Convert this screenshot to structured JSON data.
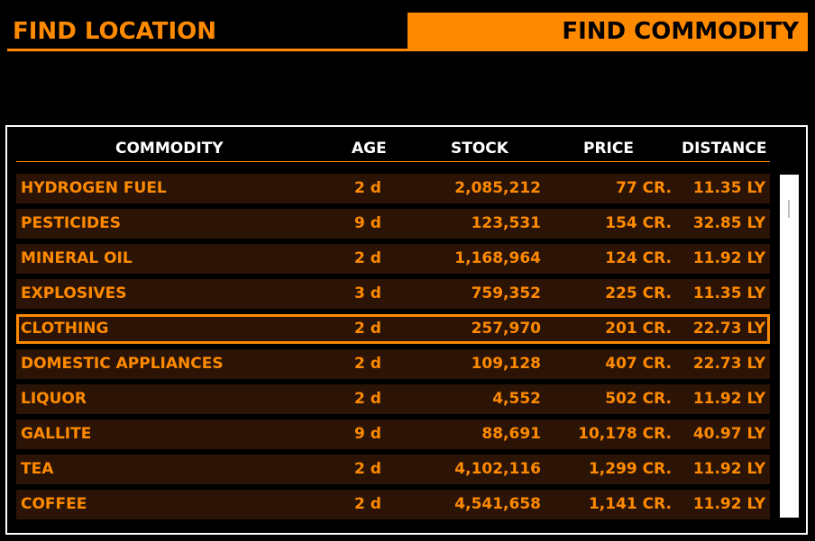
{
  "tabs": {
    "find_location": "FIND LOCATION",
    "find_commodity": "FIND COMMODITY",
    "active": "find_commodity"
  },
  "table": {
    "headers": {
      "commodity": "COMMODITY",
      "age": "AGE",
      "stock": "STOCK",
      "price": "PRICE",
      "distance": "DISTANCE"
    },
    "rows": [
      {
        "commodity": "HYDROGEN FUEL",
        "age": "2 d",
        "stock": "2,085,212",
        "price": "77 CR.",
        "distance": "11.35 LY"
      },
      {
        "commodity": "PESTICIDES",
        "age": "9 d",
        "stock": "123,531",
        "price": "154 CR.",
        "distance": "32.85 LY"
      },
      {
        "commodity": "MINERAL OIL",
        "age": "2 d",
        "stock": "1,168,964",
        "price": "124 CR.",
        "distance": "11.92 LY"
      },
      {
        "commodity": "EXPLOSIVES",
        "age": "3 d",
        "stock": "759,352",
        "price": "225 CR.",
        "distance": "11.35 LY"
      },
      {
        "commodity": "CLOTHING",
        "age": "2 d",
        "stock": "257,970",
        "price": "201 CR.",
        "distance": "22.73 LY"
      },
      {
        "commodity": "DOMESTIC APPLIANCES",
        "age": "2 d",
        "stock": "109,128",
        "price": "407 CR.",
        "distance": "22.73 LY"
      },
      {
        "commodity": "LIQUOR",
        "age": "2 d",
        "stock": "4,552",
        "price": "502 CR.",
        "distance": "11.92 LY"
      },
      {
        "commodity": "GALLITE",
        "age": "9 d",
        "stock": "88,691",
        "price": "10,178 CR.",
        "distance": "40.97 LY"
      },
      {
        "commodity": "TEA",
        "age": "2 d",
        "stock": "4,102,116",
        "price": "1,299 CR.",
        "distance": "11.92 LY"
      },
      {
        "commodity": "COFFEE",
        "age": "2 d",
        "stock": "4,541,658",
        "price": "1,141 CR.",
        "distance": "11.92 LY"
      }
    ],
    "selected_index": 4
  },
  "colors": {
    "accent": "#ff8a00",
    "row_bg": "#2b1406",
    "header_text": "#ffffff",
    "background": "#000000"
  }
}
